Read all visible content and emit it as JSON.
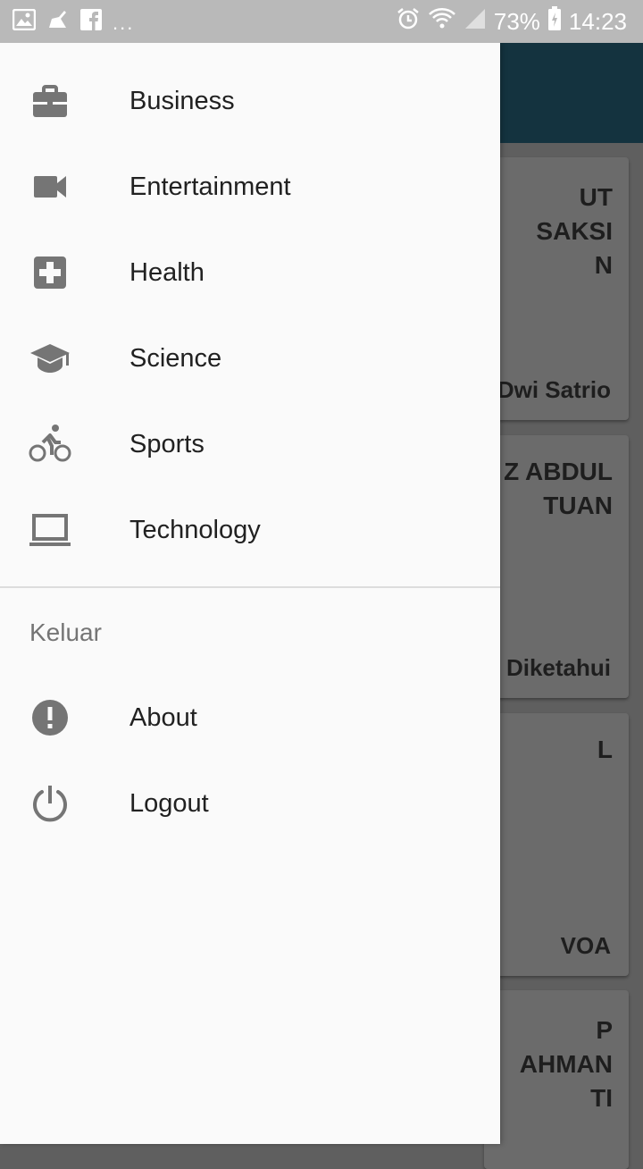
{
  "status_bar": {
    "notification_icons": [
      "gallery-icon",
      "clean-icon",
      "facebook-icon"
    ],
    "overflow": "...",
    "battery": "73%",
    "time": "14:23",
    "right_icons": [
      "alarm-icon",
      "wifi-icon",
      "signal-icon",
      "battery-icon"
    ]
  },
  "drawer": {
    "items": [
      {
        "label": "Business",
        "icon": "briefcase-icon"
      },
      {
        "label": "Entertainment",
        "icon": "video-camera-icon"
      },
      {
        "label": "Health",
        "icon": "medical-plus-icon"
      },
      {
        "label": "Science",
        "icon": "graduation-cap-icon"
      },
      {
        "label": "Sports",
        "icon": "bicycle-icon"
      },
      {
        "label": "Technology",
        "icon": "laptop-icon"
      }
    ],
    "section_title": "Keluar",
    "section_items": [
      {
        "label": "About",
        "icon": "info-alert-icon"
      },
      {
        "label": "Logout",
        "icon": "power-icon"
      }
    ]
  },
  "background_cards": [
    {
      "title": "UT\n SAKSI\nN",
      "source": "Dwi Satrio"
    },
    {
      "title": "Z ABDUL\nTUAN",
      "source": "Diketahui"
    },
    {
      "title": "L",
      "source": "VOA"
    },
    {
      "title": "P\nAHMAN\nTI",
      "source": ""
    }
  ],
  "colors": {
    "drawer_bg": "#fafafa",
    "icon": "#757575",
    "text": "#212121",
    "scrim_app_bar": "#14333f",
    "status_bar": "#b9b9b9"
  }
}
